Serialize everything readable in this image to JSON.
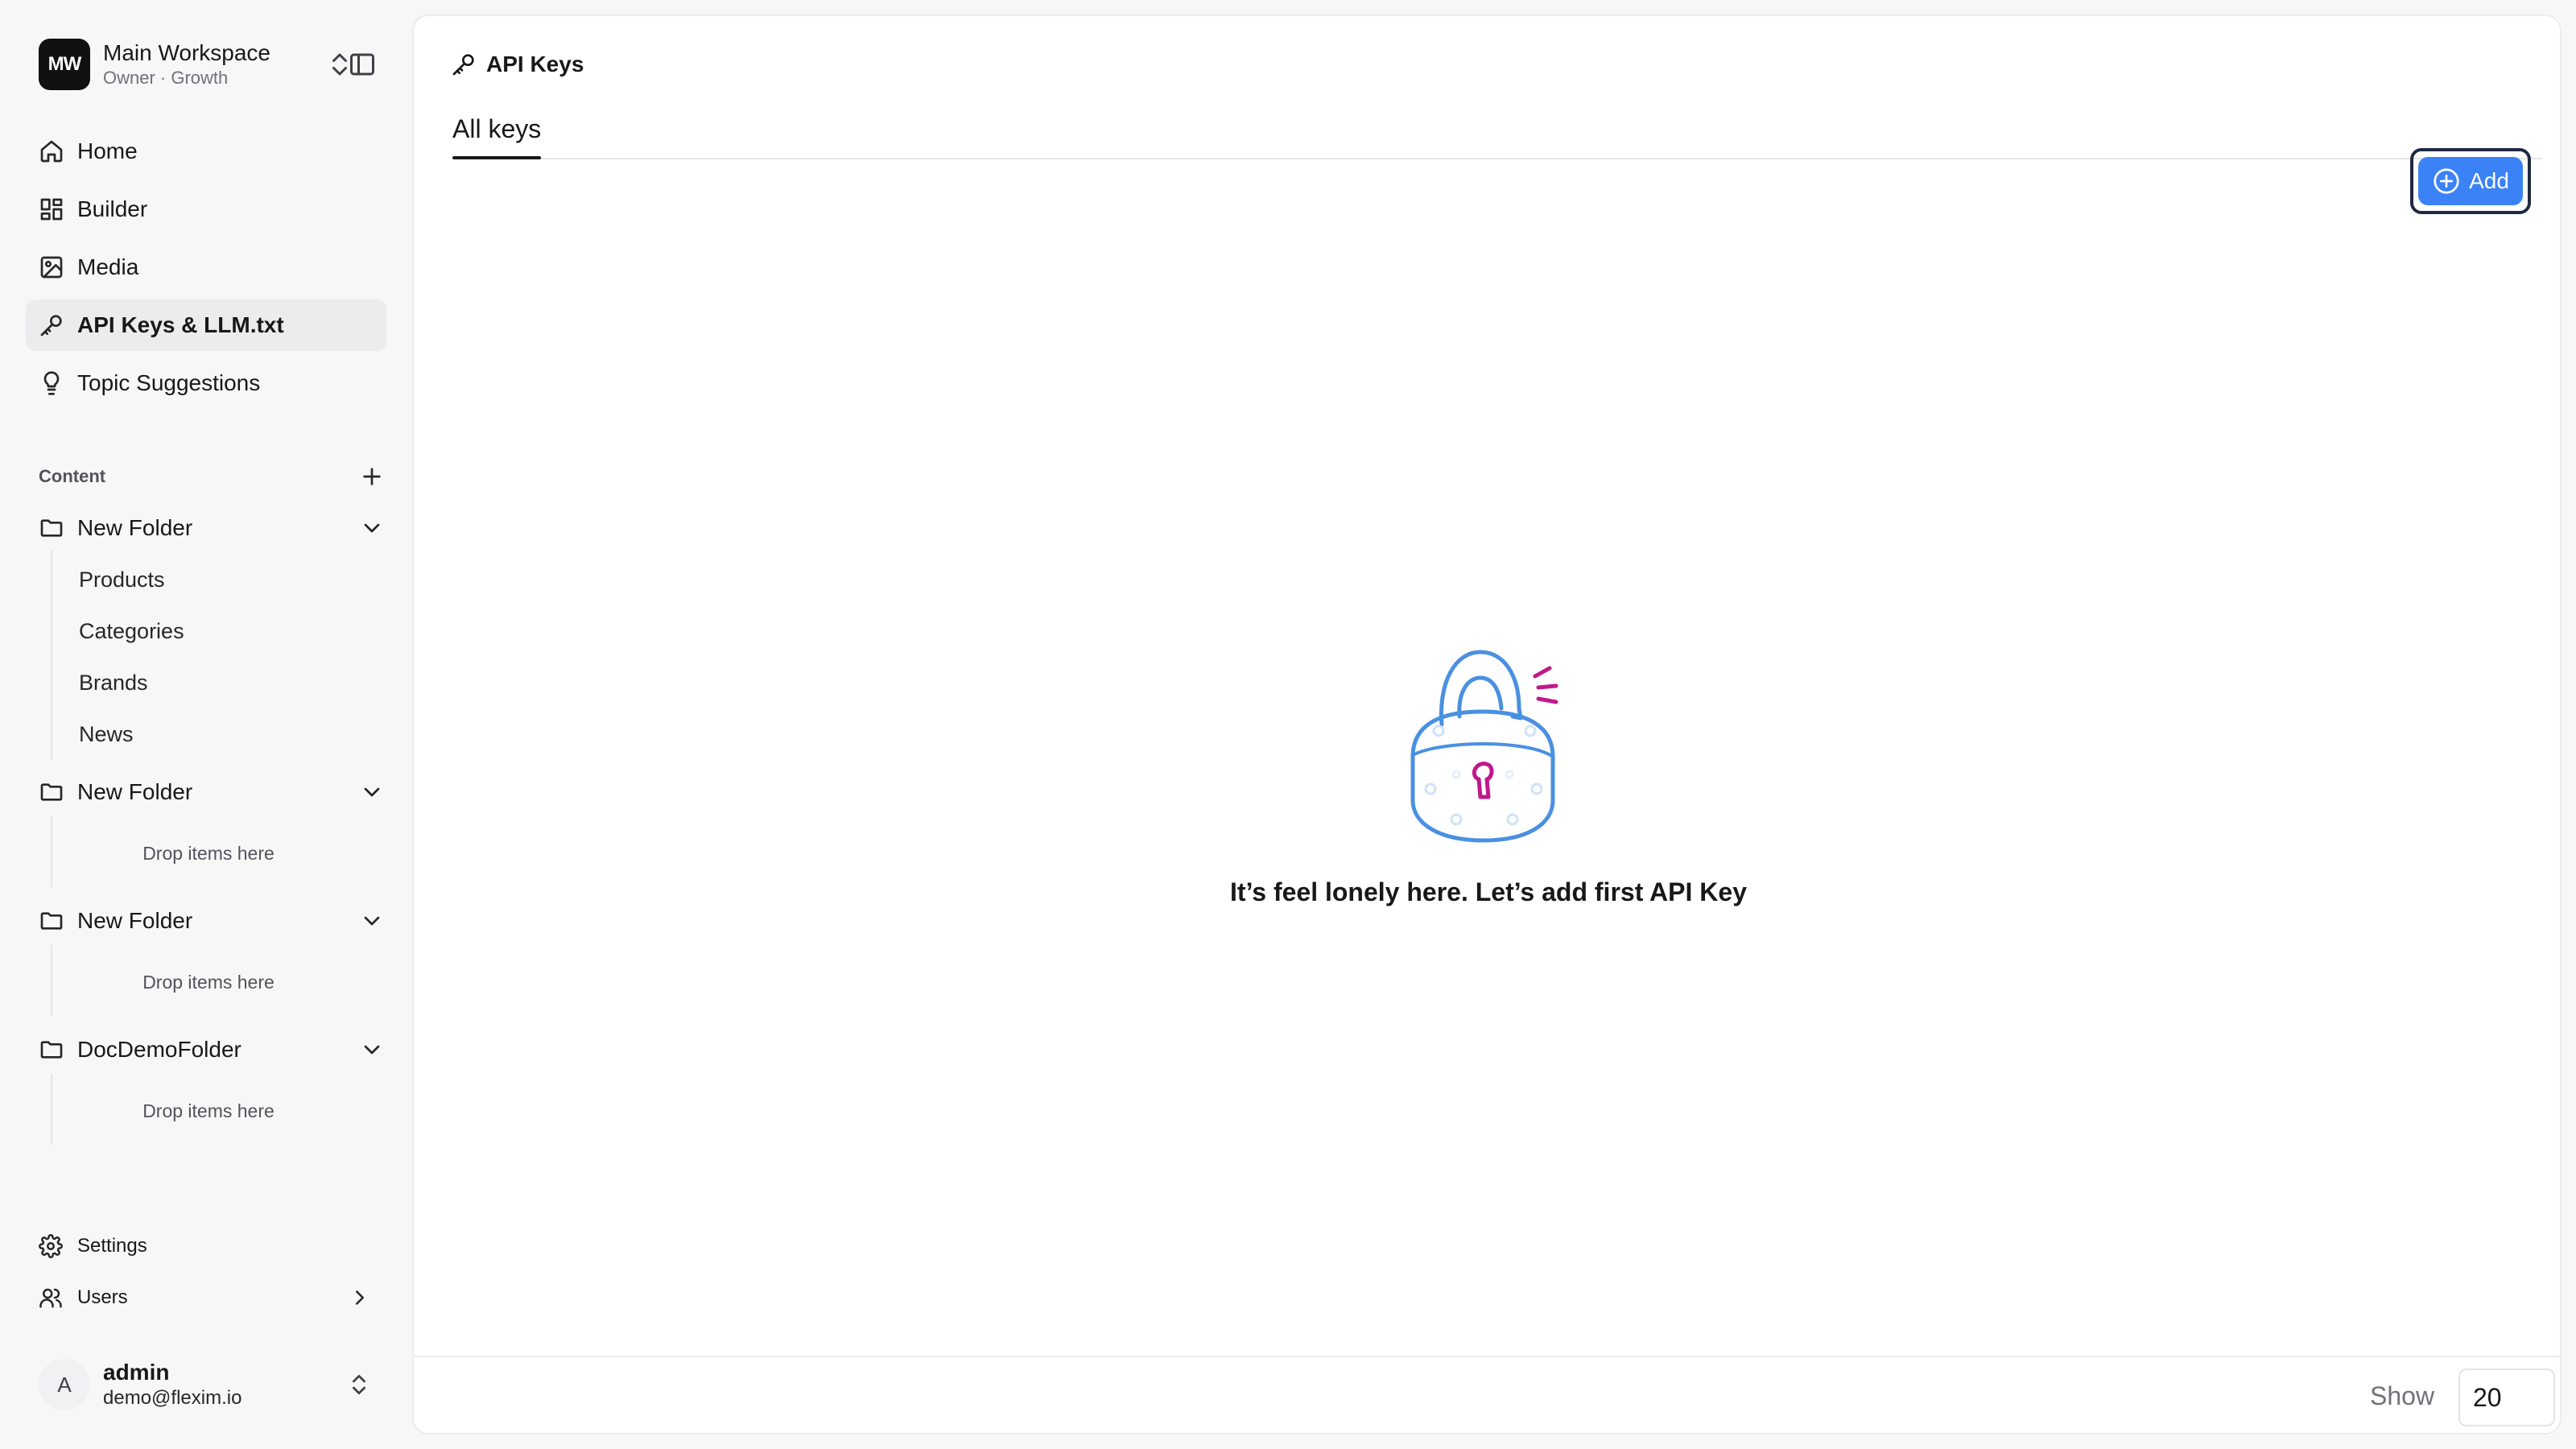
{
  "workspace": {
    "initials": "MW",
    "name": "Main Workspace",
    "subtitle": "Owner · Growth"
  },
  "nav": [
    {
      "label": "Home",
      "icon": "home-icon",
      "active": false
    },
    {
      "label": "Builder",
      "icon": "grid-icon",
      "active": false
    },
    {
      "label": "Media",
      "icon": "image-icon",
      "active": false
    },
    {
      "label": "API Keys & LLM.txt",
      "icon": "key-icon",
      "active": true
    },
    {
      "label": "Topic Suggestions",
      "icon": "lightbulb-icon",
      "active": false
    }
  ],
  "content": {
    "label": "Content",
    "folders": [
      {
        "name": "New Folder",
        "items": [
          "Products",
          "Categories",
          "Brands",
          "News"
        ],
        "drop_text": ""
      },
      {
        "name": "New Folder",
        "items": [],
        "drop_text": "Drop items here"
      },
      {
        "name": "New Folder",
        "items": [],
        "drop_text": "Drop items here"
      },
      {
        "name": "DocDemoFolder",
        "items": [],
        "drop_text": "Drop items here"
      }
    ]
  },
  "bottom_nav": {
    "settings": "Settings",
    "users": "Users"
  },
  "user": {
    "initial": "A",
    "name": "admin",
    "email": "demo@flexim.io"
  },
  "page": {
    "title": "API Keys",
    "tab": "All keys",
    "add_label": "Add",
    "empty_text": "It’s feel lonely here. Let’s add first API Key"
  },
  "footer": {
    "show_label": "Show",
    "page_size": "20"
  },
  "colors": {
    "accent": "#3b82f6",
    "lock_outline": "#4a90e2",
    "keyhole": "#c2188b"
  }
}
